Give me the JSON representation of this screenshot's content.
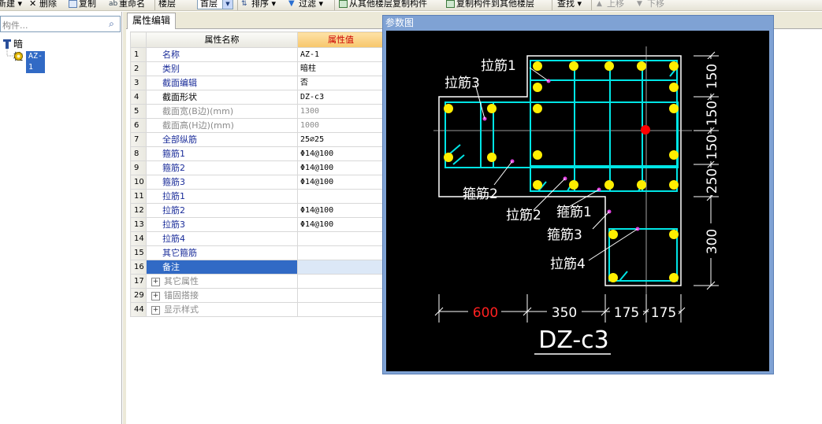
{
  "toolbar": {
    "new_label": "新建",
    "delete_label": "删除",
    "copy_label": "复制",
    "rename_label": "重命名",
    "floor_label": "楼层",
    "floor_value": "首层",
    "sort_label": "排序",
    "filter_label": "过滤",
    "copy_from_label": "从其他楼层复制构件",
    "copy_to_label": "复制构件到其他楼层",
    "find_label": "查找",
    "move_up_label": "上移",
    "move_down_label": "下移"
  },
  "left_panel": {
    "search_placeholder": "构件...",
    "tree_root": "暗柱",
    "tree_child": "AZ-1"
  },
  "tab": {
    "label": "属性编辑"
  },
  "grid": {
    "headers": {
      "name": "属性名称",
      "value": "属性值"
    },
    "rows": [
      {
        "num": "1",
        "name": "名称",
        "value": "AZ-1"
      },
      {
        "num": "2",
        "name": "类别",
        "value": "暗柱"
      },
      {
        "num": "3",
        "name": "截面编辑",
        "value": "否"
      },
      {
        "num": "4",
        "name": "截面形状",
        "value": "DZ-c3"
      },
      {
        "num": "5",
        "name": "截面宽(B边)(mm)",
        "value": "1300"
      },
      {
        "num": "6",
        "name": "截面高(H边)(mm)",
        "value": "1000"
      },
      {
        "num": "7",
        "name": "全部纵筋",
        "value": "25⌀25"
      },
      {
        "num": "8",
        "name": "箍筋1",
        "value": "Φ14@100"
      },
      {
        "num": "9",
        "name": "箍筋2",
        "value": "Φ14@100"
      },
      {
        "num": "10",
        "name": "箍筋3",
        "value": "Φ14@100"
      },
      {
        "num": "11",
        "name": "拉筋1",
        "value": ""
      },
      {
        "num": "12",
        "name": "拉筋2",
        "value": "Φ14@100"
      },
      {
        "num": "13",
        "name": "拉筋3",
        "value": "Φ14@100"
      },
      {
        "num": "14",
        "name": "拉筋4",
        "value": ""
      },
      {
        "num": "15",
        "name": "其它箍筋",
        "value": ""
      },
      {
        "num": "16",
        "name": "备注",
        "value": ""
      },
      {
        "num": "17",
        "name": "其它属性",
        "value": ""
      },
      {
        "num": "29",
        "name": "锚固搭接",
        "value": ""
      },
      {
        "num": "44",
        "name": "显示样式",
        "value": ""
      }
    ]
  },
  "dialog": {
    "title": "参数图",
    "labels": {
      "la1": "拉筋1",
      "la3": "拉筋3",
      "gu2": "箍筋2",
      "la2": "拉筋2",
      "gu1": "箍筋1",
      "gu3": "箍筋3",
      "la4": "拉筋4"
    },
    "dims_bottom": [
      "600",
      "350",
      "175",
      "175"
    ],
    "dims_right": [
      "150",
      "150",
      "150",
      "250",
      "300"
    ],
    "section_name": "DZ-c3",
    "colors": {
      "outline": "#ffffff",
      "rebar": "#00e5e5",
      "bar": "#ffee00",
      "pink": "#e040e0",
      "center": "#ff0000",
      "dim_red": "#ff2020"
    }
  }
}
